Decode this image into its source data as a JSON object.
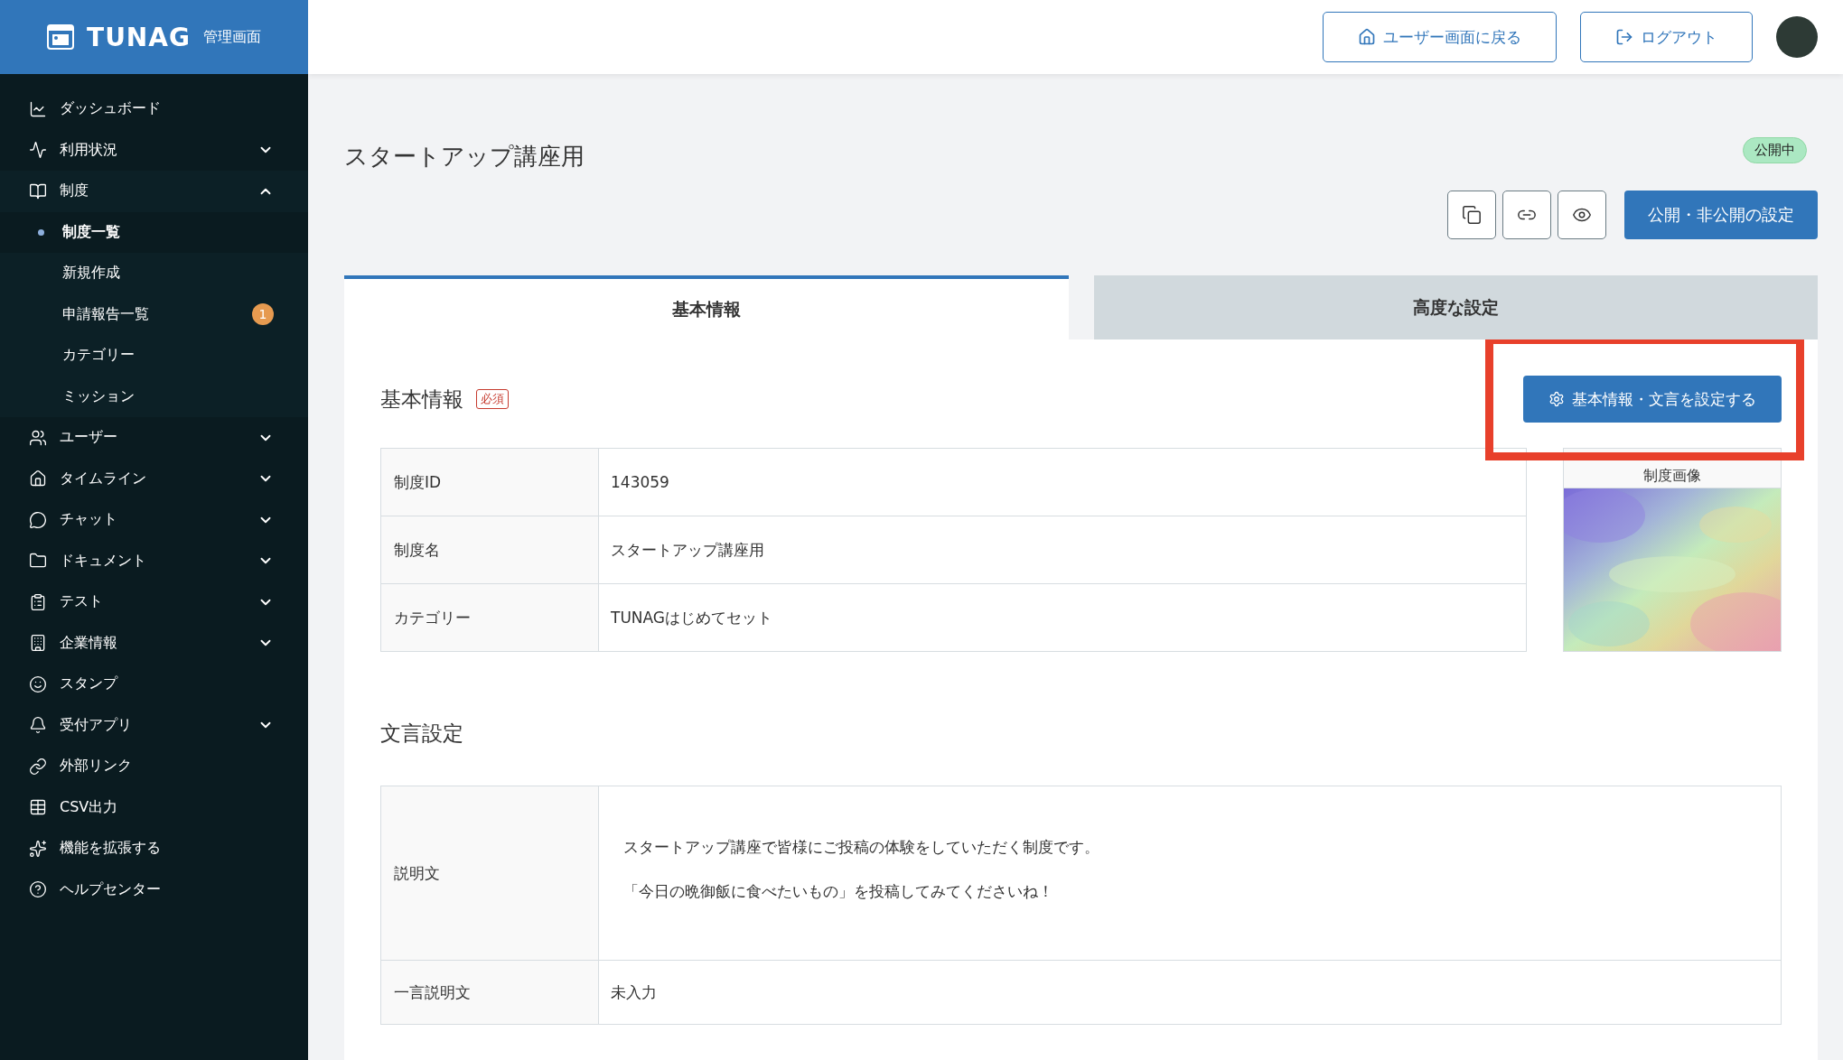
{
  "brand": {
    "name": "TUNAG",
    "subtitle": "管理画面"
  },
  "sidebar": {
    "items": [
      {
        "label": "ダッシュボード"
      },
      {
        "label": "利用状況",
        "expanded": false
      },
      {
        "label": "制度",
        "expanded": true,
        "children": [
          {
            "label": "制度一覧",
            "selected": true
          },
          {
            "label": "新規作成",
            "selected": false
          },
          {
            "label": "申請報告一覧",
            "selected": false,
            "badge": "1"
          },
          {
            "label": "カテゴリー",
            "selected": false
          },
          {
            "label": "ミッション",
            "selected": false
          }
        ]
      },
      {
        "label": "ユーザー",
        "expanded": false
      },
      {
        "label": "タイムライン",
        "expanded": false
      },
      {
        "label": "チャット",
        "expanded": false
      },
      {
        "label": "ドキュメント",
        "expanded": false
      },
      {
        "label": "テスト",
        "expanded": false
      },
      {
        "label": "企業情報",
        "expanded": false
      },
      {
        "label": "スタンプ"
      },
      {
        "label": "受付アプリ",
        "expanded": false
      },
      {
        "label": "外部リンク"
      },
      {
        "label": "CSV出力"
      },
      {
        "label": "機能を拡張する"
      },
      {
        "label": "ヘルプセンター"
      }
    ]
  },
  "header": {
    "buttons": [
      {
        "label": "ユーザー画面に戻る"
      },
      {
        "label": "ログアウト"
      }
    ]
  },
  "page": {
    "title": "スタートアップ講座用",
    "status": "公開中",
    "primary_button": "公開・非公開の設定"
  },
  "tabs": [
    {
      "label": "基本情報",
      "selected": true
    },
    {
      "label": "高度な設定",
      "selected": false
    }
  ],
  "basic_info": {
    "heading": "基本情報",
    "required_badge": "必須",
    "edit_button": {
      "label": "基本情報・文言を設定する",
      "highlighted": true
    },
    "rows": [
      {
        "label": "制度ID",
        "value": "143059"
      },
      {
        "label": "制度名",
        "value": "スタートアップ講座用"
      },
      {
        "label": "カテゴリー",
        "value": "TUNAGはじめてセット"
      }
    ],
    "image": {
      "label": "制度画像",
      "kind": "picture"
    }
  },
  "text_settings": {
    "heading": "文言設定",
    "rows": [
      {
        "label": "説明文",
        "paragraphs": [
          "スタートアップ講座で皆様にご投稿の体験をしていただく制度です。",
          "「今日の晩御飯に食べたいもの」を投稿してみてくださいね！"
        ]
      },
      {
        "label": "一言説明文",
        "paragraphs": [
          "未入力"
        ]
      }
    ]
  }
}
